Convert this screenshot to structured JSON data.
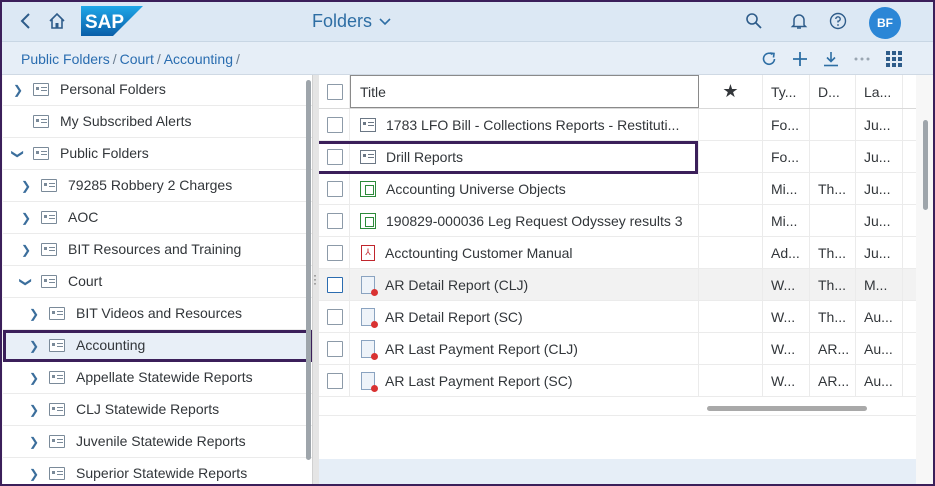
{
  "shell": {
    "title": "Folders",
    "logo_text": "SAP",
    "avatar_initials": "BF"
  },
  "breadcrumb": [
    "Public Folders",
    "Court",
    "Accounting"
  ],
  "breadcrumb_sep": "/",
  "tree": [
    {
      "label": "Personal Folders",
      "level": 0,
      "expand": "collapsed"
    },
    {
      "label": "My Subscribed Alerts",
      "level": 0,
      "expand": "none"
    },
    {
      "label": "Public Folders",
      "level": 0,
      "expand": "expanded"
    },
    {
      "label": "79285 Robbery 2 Charges",
      "level": 1,
      "expand": "collapsed"
    },
    {
      "label": "AOC",
      "level": 1,
      "expand": "collapsed"
    },
    {
      "label": "BIT Resources and Training",
      "level": 1,
      "expand": "collapsed"
    },
    {
      "label": "Court",
      "level": 1,
      "expand": "expanded"
    },
    {
      "label": "BIT Videos and Resources",
      "level": 2,
      "expand": "collapsed"
    },
    {
      "label": "Accounting",
      "level": 2,
      "expand": "collapsed",
      "selected": true
    },
    {
      "label": "Appellate Statewide Reports",
      "level": 2,
      "expand": "collapsed"
    },
    {
      "label": "CLJ Statewide Reports",
      "level": 2,
      "expand": "collapsed"
    },
    {
      "label": "Juvenile Statewide Reports",
      "level": 2,
      "expand": "collapsed"
    },
    {
      "label": "Superior Statewide Reports",
      "level": 2,
      "expand": "collapsed"
    }
  ],
  "table": {
    "headers": {
      "title": "Title",
      "favorite": "★",
      "type": "Ty...",
      "desc": "D...",
      "last": "La..."
    },
    "rows": [
      {
        "icon": "folder",
        "title": "1783 LFO Bill - Collections Reports - Restituti...",
        "type": "Fo...",
        "desc": "",
        "last": "Ju..."
      },
      {
        "icon": "folder",
        "title": "Drill Reports",
        "type": "Fo...",
        "desc": "",
        "last": "Ju..."
      },
      {
        "icon": "universe",
        "title": "Accounting Universe Objects",
        "type": "Mi...",
        "desc": "Th...",
        "last": "Ju..."
      },
      {
        "icon": "universe",
        "title": "190829-000036 Leg Request Odyssey results 3",
        "type": "Mi...",
        "desc": "",
        "last": "Ju..."
      },
      {
        "icon": "pdf",
        "title": "Acctounting Customer Manual",
        "type": "Ad...",
        "desc": "Th...",
        "last": "Ju..."
      },
      {
        "icon": "webi",
        "title": "AR Detail Report (CLJ)",
        "type": "W...",
        "desc": "Th...",
        "last": "M..."
      },
      {
        "icon": "webi",
        "title": "AR Detail Report (SC)",
        "type": "W...",
        "desc": "Th...",
        "last": "Au..."
      },
      {
        "icon": "webi",
        "title": "AR Last Payment Report (CLJ)",
        "type": "W...",
        "desc": "AR...",
        "last": "Au..."
      },
      {
        "icon": "webi",
        "title": "AR Last Payment Report (SC)",
        "type": "W...",
        "desc": "AR...",
        "last": "Au..."
      }
    ]
  },
  "colors": {
    "accent": "#2a6db0",
    "highlight_border": "#3b1f5a",
    "avatar": "#2b86d6"
  }
}
